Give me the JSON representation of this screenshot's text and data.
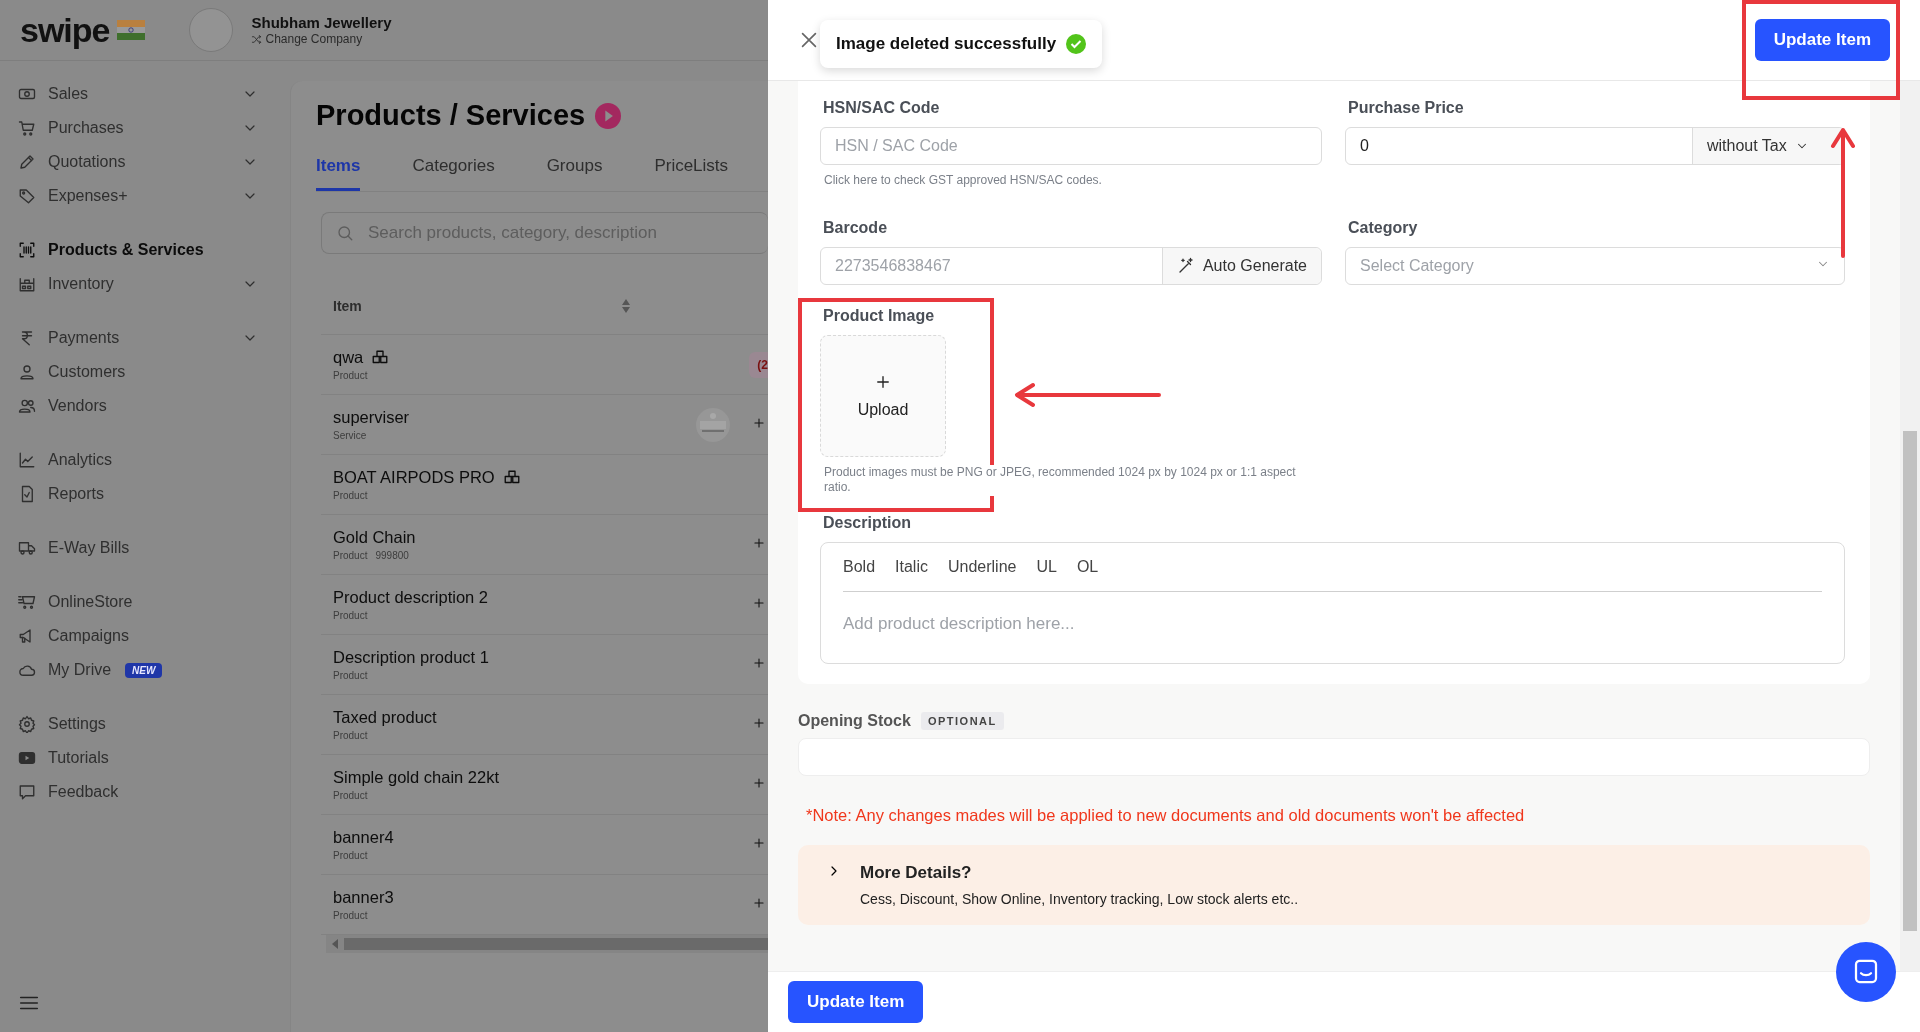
{
  "brand": {
    "name": "swipe"
  },
  "company": {
    "name": "Shubham Jewellery",
    "action": "Change Company"
  },
  "sidebar": {
    "groups": [
      {
        "items": [
          {
            "label": "Sales",
            "expandable": true,
            "selected": false
          },
          {
            "label": "Purchases",
            "expandable": true,
            "selected": false
          },
          {
            "label": "Quotations",
            "expandable": true,
            "selected": false
          },
          {
            "label": "Expenses+",
            "expandable": true,
            "selected": false
          }
        ]
      },
      {
        "items": [
          {
            "label": "Products & Services",
            "expandable": false,
            "selected": true
          },
          {
            "label": "Inventory",
            "expandable": true,
            "selected": false
          }
        ]
      },
      {
        "items": [
          {
            "label": "Payments",
            "expandable": true,
            "selected": false
          },
          {
            "label": "Customers",
            "expandable": false,
            "selected": false
          },
          {
            "label": "Vendors",
            "expandable": false,
            "selected": false
          }
        ]
      },
      {
        "items": [
          {
            "label": "Analytics",
            "expandable": false,
            "selected": false
          },
          {
            "label": "Reports",
            "expandable": false,
            "selected": false
          }
        ]
      },
      {
        "items": [
          {
            "label": "E-Way Bills",
            "expandable": false,
            "selected": false
          }
        ]
      },
      {
        "items": [
          {
            "label": "OnlineStore",
            "expandable": false,
            "selected": false
          },
          {
            "label": "Campaigns",
            "expandable": false,
            "selected": false
          },
          {
            "label": "My Drive",
            "expandable": false,
            "selected": false,
            "badge": "NEW"
          }
        ]
      },
      {
        "items": [
          {
            "label": "Settings",
            "expandable": false,
            "selected": false
          },
          {
            "label": "Tutorials",
            "expandable": false,
            "selected": false
          },
          {
            "label": "Feedback",
            "expandable": false,
            "selected": false
          }
        ]
      }
    ]
  },
  "page": {
    "title": "Products / Services",
    "tabs": [
      {
        "label": "Items",
        "selected": true
      },
      {
        "label": "Categories",
        "selected": false
      },
      {
        "label": "Groups",
        "selected": false
      },
      {
        "label": "PriceLists",
        "selected": false
      }
    ],
    "search": {
      "placeholder": "Search products, category, description"
    },
    "table": {
      "columns": [
        "Item"
      ],
      "rows": [
        {
          "name": "qwa",
          "type": "Product",
          "inventory": true,
          "badge": "(2",
          "has_image": false,
          "add_button": false
        },
        {
          "name": "superviser",
          "type": "Service",
          "inventory": false,
          "has_image": true,
          "add_button": true
        },
        {
          "name": "BOAT AIRPODS PRO",
          "type": "Product",
          "inventory": true,
          "has_image": false,
          "add_button": false
        },
        {
          "name": "Gold Chain",
          "type": "Product",
          "code": "999800",
          "inventory": false,
          "has_image": false,
          "add_button": true
        },
        {
          "name": "Product description 2",
          "type": "Product",
          "inventory": false,
          "has_image": false,
          "add_button": true
        },
        {
          "name": "Description product 1",
          "type": "Product",
          "inventory": false,
          "has_image": false,
          "add_button": true
        },
        {
          "name": "Taxed product",
          "type": "Product",
          "inventory": false,
          "has_image": false,
          "add_button": true
        },
        {
          "name": "Simple gold chain 22kt",
          "type": "Product",
          "inventory": false,
          "has_image": false,
          "add_button": true
        },
        {
          "name": "banner4",
          "type": "Product",
          "inventory": false,
          "has_image": false,
          "add_button": true
        },
        {
          "name": "banner3",
          "type": "Product",
          "inventory": false,
          "has_image": false,
          "add_button": true
        }
      ]
    }
  },
  "drawer": {
    "toast": {
      "message": "Image deleted successfully"
    },
    "header_button": "Update Item",
    "hsn": {
      "label": "HSN/SAC Code",
      "placeholder": "HSN / SAC Code",
      "hint": "Click here to check GST approved HSN/SAC codes."
    },
    "purchase_price": {
      "label": "Purchase Price",
      "value": "0",
      "tax_mode": "without Tax"
    },
    "barcode": {
      "label": "Barcode",
      "placeholder": "2273546838467",
      "action": "Auto Generate"
    },
    "category": {
      "label": "Category",
      "placeholder": "Select Category"
    },
    "product_image": {
      "label": "Product Image",
      "upload": "Upload",
      "hint": "Product images must be PNG or JPEG, recommended 1024 px by 1024 px or 1:1 aspect ratio."
    },
    "description": {
      "label": "Description",
      "toolbar": [
        "Bold",
        "Italic",
        "Underline",
        "UL",
        "OL"
      ],
      "placeholder": "Add product description here..."
    },
    "opening_stock": {
      "label": "Opening Stock",
      "tag": "OPTIONAL"
    },
    "note": "*Note: Any changes mades will be applied to new documents and old documents won't be affected",
    "more_details": {
      "title": "More Details?",
      "subtitle": "Cess, Discount, Show Online, Inventory tracking, Low stock alerts etc..",
      "expanded": false
    },
    "footer_button": "Update Item"
  }
}
